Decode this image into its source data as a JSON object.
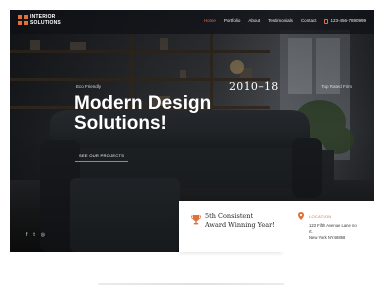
{
  "brand": {
    "name_line1": "INTERIOR",
    "name_line2": "SOLUTIONS",
    "accent_color": "#e2703a"
  },
  "nav": {
    "items": [
      {
        "label": "Home",
        "active": true
      },
      {
        "label": "Portfolio",
        "active": false
      },
      {
        "label": "About",
        "active": false
      },
      {
        "label": "Testimonials",
        "active": false
      },
      {
        "label": "Contact",
        "active": false
      }
    ],
    "phone": "123-456-7890999"
  },
  "hero": {
    "eyebrow_left": "Eco Friendly",
    "eyebrow_right": "Top Rated Firm",
    "years": "2010–18",
    "headline_line1": "Modern Design",
    "headline_line2": "Solutions!",
    "cta_label": "SEE OUR PROJECTS"
  },
  "socials": [
    {
      "icon": "facebook-icon",
      "label": "f"
    },
    {
      "icon": "twitter-icon",
      "label": "t"
    },
    {
      "icon": "instagram-icon",
      "label": "◎"
    }
  ],
  "award": {
    "icon": "trophy-icon",
    "text": "5th Consistent Award Winning Year!"
  },
  "location": {
    "icon": "map-pin-icon",
    "label": "LOCATION",
    "address_line1": "123 Fifth Avenue Lane no",
    "address_line2": "rt.",
    "address_line3": "New York NY46858"
  }
}
